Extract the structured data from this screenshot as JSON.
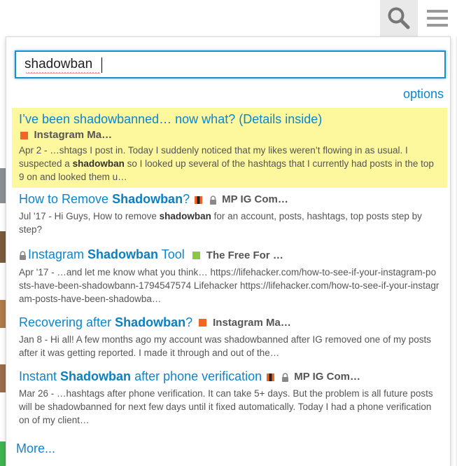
{
  "header": {
    "search_icon": "search-icon",
    "menu_icon": "hamburger-menu-icon"
  },
  "search": {
    "value": "shadowban"
  },
  "options_label": "options",
  "more_label": "More...",
  "colors": {
    "link": "#0c85d0",
    "highlight": "#fdf79d",
    "focus_border": "#1a8ec8"
  },
  "results": [
    {
      "title": "I’ve been shadowbanned… now what? (Details inside)",
      "category": "Instagram Ma…",
      "category_color": "#f26522",
      "excerpt_pre": "Apr 2 - …shtags I post in. Today I suddenly noticed that my likes weren’t flowing in as usual. I suspected a ",
      "excerpt_bold": "shadowban",
      "excerpt_post": " so I looked up several of the hashtags that I currently had posts in the top 9 on and looked them u…"
    },
    {
      "title_pre": "How to Remove ",
      "title_bold": "Shadowban",
      "title_post": "?",
      "category": "MP IG Com…",
      "excerpt_pre": "Jul '17 - Hi Guys, How to remove ",
      "excerpt_bold": "shadowban",
      "excerpt_post": " for an account, posts, hashtags, top posts step by step?"
    },
    {
      "title_pre": "Instagram ",
      "title_bold": "Shadowban",
      "title_post": " Tool",
      "category": "The Free For …",
      "category_color": "#8dc63f",
      "excerpt": "Apr '17 - …and let me know what you think… https://lifehacker.com/how-to-see-if-your-instagram-posts-have-been-shadowbann-1794547574 Lifehacker https://lifehacker.com/how-to-see-if-your-instagram-posts-have-been-shadowba…"
    },
    {
      "title_pre": "Recovering after ",
      "title_bold": "Shadowban",
      "title_post": "?",
      "category": "Instagram Ma…",
      "category_color": "#f26522",
      "excerpt": "Jan 8 - Hi all! A few months ago my account was shadowbanned after IG removed one of my posts after it was getting reported. I made it through and out of the…"
    },
    {
      "title_pre": "Instant ",
      "title_bold": "Shadowban",
      "title_post": " after phone verification",
      "category": "MP IG Com…",
      "excerpt": "Mar 26 - …hashtags after phone verification. It can take 5+ days. But the problem is all future posts will be shadowbanned for next few days until it fixed automatically. Today I had a phone verification on of my client…"
    }
  ]
}
